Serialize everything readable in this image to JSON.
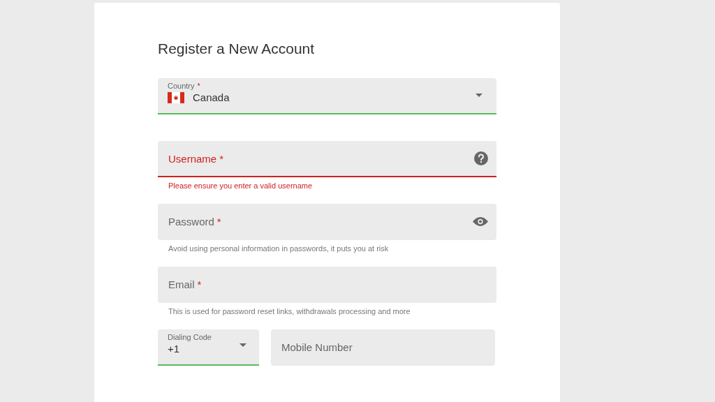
{
  "title": "Register a New Account",
  "fields": [
    {
      "kind": "select",
      "label": "Country",
      "required_mark": "*",
      "value": "Canada",
      "valid": true,
      "error": false
    },
    {
      "kind": "help",
      "label": "Username",
      "required_mark": "*",
      "error": true,
      "helper": "Please ensure you enter a valid username"
    },
    {
      "kind": "password",
      "label": "Password",
      "required_mark": "*",
      "valid": false,
      "error": false,
      "helper": "Avoid using personal information in passwords, it puts you at risk"
    },
    {
      "kind": "text",
      "label": "Email",
      "required_mark": "*",
      "valid": false,
      "error": false,
      "helper": "This is used for password reset links, withdrawals processing and more"
    }
  ],
  "phone": {
    "dialing_code": {
      "label": "Dialing Code",
      "value": "+1",
      "valid": true
    },
    "mobile": {
      "label": "Mobile Number",
      "valid": false
    }
  }
}
